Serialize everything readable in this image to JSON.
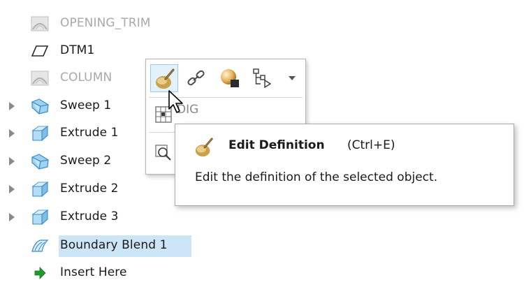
{
  "tree": {
    "items": [
      {
        "label": "OPENING_TRIM",
        "icon": "surface-trim-icon",
        "expandable": false,
        "dimmed": true,
        "selected": false
      },
      {
        "label": "DTM1",
        "icon": "datum-plane-icon",
        "expandable": false,
        "dimmed": false,
        "selected": false
      },
      {
        "label": "COLUMN",
        "icon": "surface-trim-icon",
        "expandable": false,
        "dimmed": true,
        "selected": false
      },
      {
        "label": "Sweep 1",
        "icon": "sweep-icon",
        "expandable": true,
        "dimmed": false,
        "selected": false
      },
      {
        "label": "Extrude 1",
        "icon": "extrude-icon",
        "expandable": true,
        "dimmed": false,
        "selected": false
      },
      {
        "label": "Sweep 2",
        "icon": "sweep-icon",
        "expandable": true,
        "dimmed": false,
        "selected": false
      },
      {
        "label": "Extrude 2",
        "icon": "extrude-icon",
        "expandable": true,
        "dimmed": false,
        "selected": false
      },
      {
        "label": "Extrude 3",
        "icon": "extrude-icon",
        "expandable": true,
        "dimmed": false,
        "selected": false
      },
      {
        "label": "Boundary Blend 1",
        "icon": "boundary-blend-icon",
        "expandable": false,
        "dimmed": false,
        "selected": true
      },
      {
        "label": "Insert Here",
        "icon": "insert-arrow-icon",
        "expandable": false,
        "dimmed": false,
        "selected": false
      }
    ]
  },
  "mini_toolbar": {
    "buttons": [
      {
        "name": "edit-definition-icon",
        "hot": true
      },
      {
        "name": "edit-references-icon",
        "hot": false
      },
      {
        "name": "appearance-icon",
        "hot": false
      },
      {
        "name": "hierarchy-icon",
        "hot": false
      }
    ],
    "partial_row_label": "DIG",
    "dropdown_icon": "chevron-down-icon"
  },
  "tooltip": {
    "title": "Edit Definition",
    "shortcut": "(Ctrl+E)",
    "description": "Edit the definition of the selected object.",
    "icon": "edit-definition-icon"
  },
  "colors": {
    "selection": "#cde6f7",
    "toolbar_hot": "#e3f1fb",
    "dim_text": "#a9a9a9",
    "sweep": "#4a9fd6",
    "insert_arrow": "#1f9b2e"
  }
}
